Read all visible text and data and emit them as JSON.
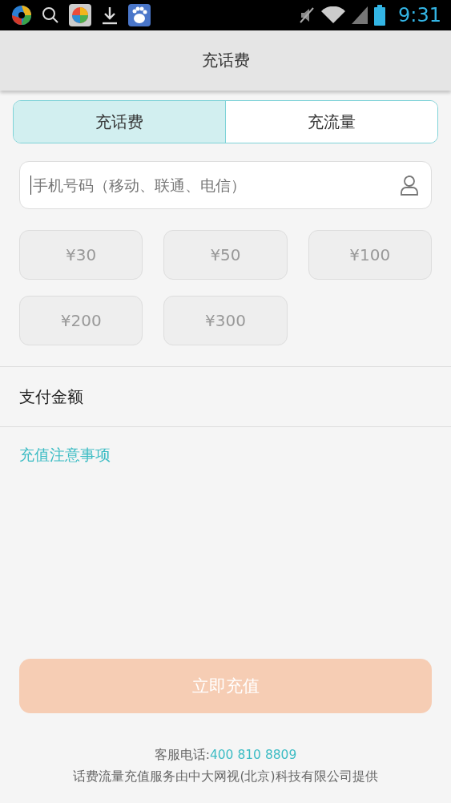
{
  "status_bar": {
    "time": "9:31"
  },
  "header": {
    "title": "充话费"
  },
  "tabs": [
    {
      "label": "充话费",
      "selected": true
    },
    {
      "label": "充流量",
      "selected": false
    }
  ],
  "phone_field": {
    "placeholder": "手机号码（移动、联通、电信）"
  },
  "amounts": [
    {
      "label": "¥30",
      "selected": false
    },
    {
      "label": "¥50",
      "selected": false
    },
    {
      "label": "¥100",
      "selected": false
    },
    {
      "label": "¥200",
      "selected": false
    },
    {
      "label": "¥300",
      "selected": false
    }
  ],
  "payment": {
    "label": "支付金额"
  },
  "notice_link": "充值注意事项",
  "submit": {
    "label": "立即充值",
    "disabled": true
  },
  "footer": {
    "hotline_label": "客服电话:",
    "hotline_number": "400 810 8809",
    "provider": "话费流量充值服务由中大网视(北京)科技有限公司提供"
  }
}
